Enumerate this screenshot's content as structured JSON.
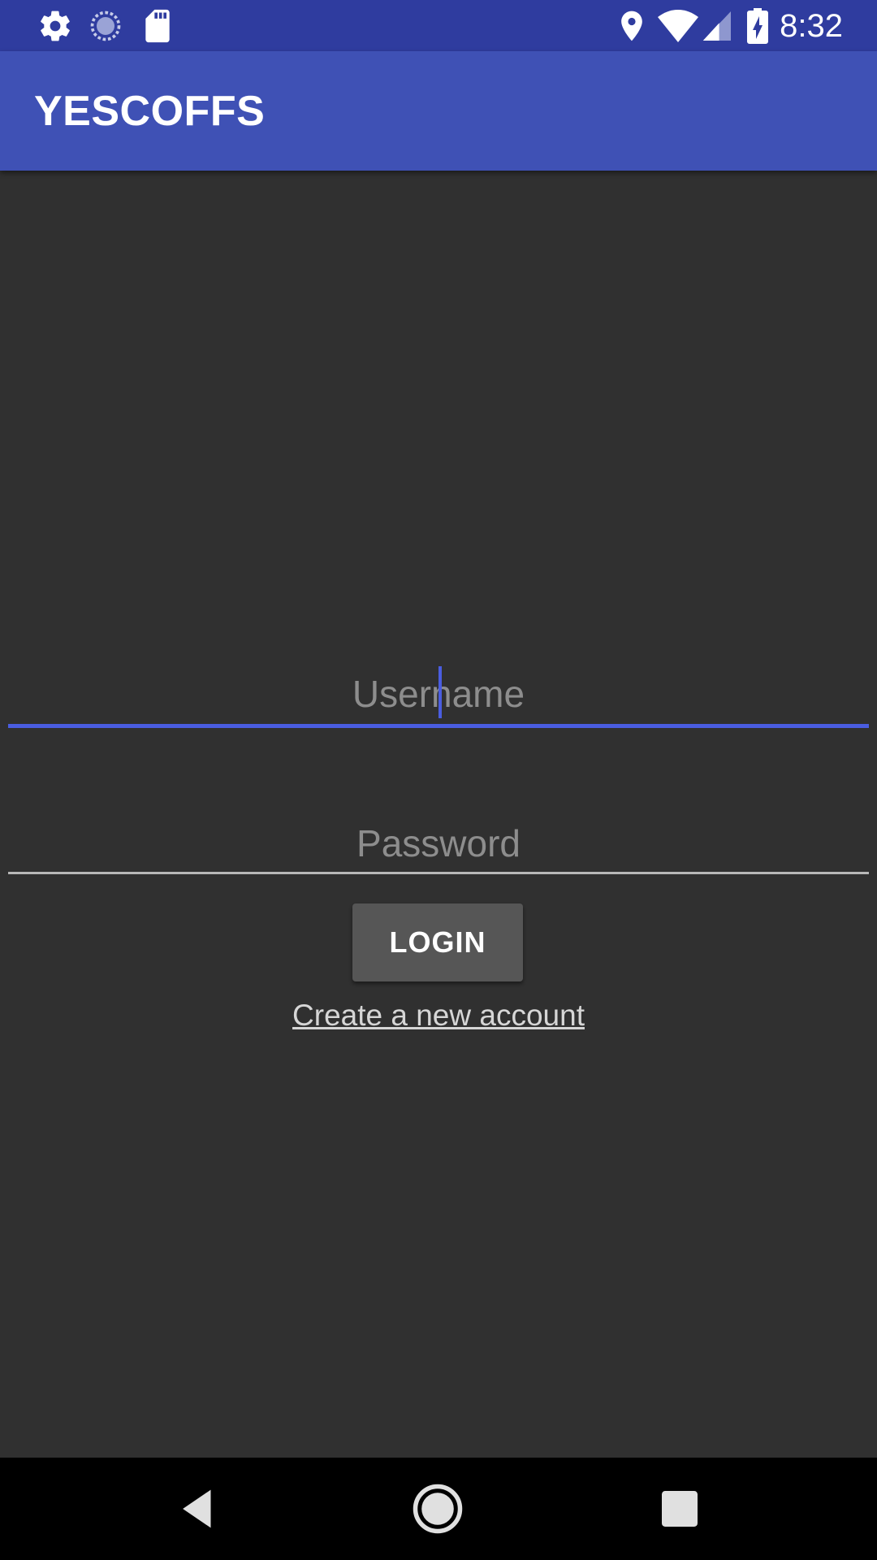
{
  "status_bar": {
    "time": "8:32",
    "left_icons": [
      "gear-icon",
      "sync-spinner-icon",
      "sd-card-icon"
    ],
    "right_icons": [
      "location-icon",
      "wifi-icon",
      "cell-signal-icon",
      "battery-charging-icon"
    ]
  },
  "app_bar": {
    "title": "YESCOFFS"
  },
  "login_form": {
    "username_placeholder": "Username",
    "password_placeholder": "Password",
    "login_label": "LOGIN",
    "create_account_link": "Create a new account"
  },
  "nav_bar": {
    "buttons": [
      "back-icon",
      "home-icon",
      "recents-icon"
    ]
  },
  "colors": {
    "status_bar": "#2f3c9f",
    "app_bar": "#3f51b5",
    "background": "#303030",
    "accent": "#4a5de0",
    "button": "#565656"
  }
}
